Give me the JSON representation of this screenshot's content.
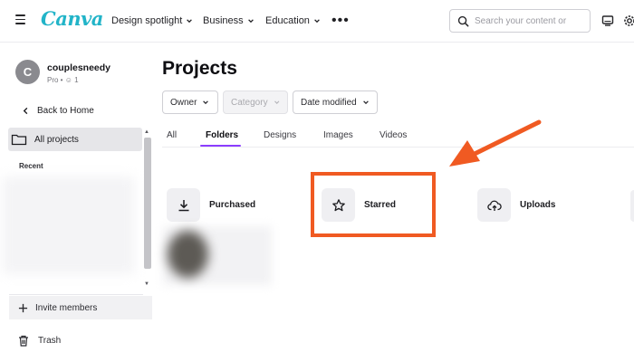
{
  "header": {
    "logo": "Canva",
    "nav": [
      "Design spotlight",
      "Business",
      "Education"
    ],
    "more": "•••",
    "search_placeholder": "Search your content or",
    "icons": [
      "menu-icon",
      "chevron-down-icon",
      "more-icon",
      "search-icon",
      "desktop-icon",
      "settings-icon"
    ]
  },
  "sidebar": {
    "avatar_initial": "C",
    "user_name": "couplesneedy",
    "user_plan": "Pro • ☺ 1",
    "back_home": "Back to Home",
    "all_projects": "All projects",
    "recent_heading": "Recent",
    "invite_members": "Invite members",
    "trash": "Trash"
  },
  "main": {
    "title": "Projects",
    "filters": [
      {
        "label": "Owner",
        "enabled": true
      },
      {
        "label": "Category",
        "enabled": false
      },
      {
        "label": "Date modified",
        "enabled": true
      }
    ],
    "tabs": [
      {
        "label": "All",
        "active": false
      },
      {
        "label": "Folders",
        "active": true
      },
      {
        "label": "Designs",
        "active": false
      },
      {
        "label": "Images",
        "active": false
      },
      {
        "label": "Videos",
        "active": false
      }
    ],
    "folders": [
      {
        "label": "Purchased",
        "icon": "download-icon"
      },
      {
        "label": "Starred",
        "icon": "star-icon"
      },
      {
        "label": "Uploads",
        "icon": "cloud-upload-icon"
      }
    ]
  },
  "annotation": {
    "color": "#f05a22",
    "highlighted": "Starred"
  },
  "colors": {
    "brand": "#22b4c8",
    "accent": "#8b3dff",
    "sidebar_active": "#e6e6e9"
  }
}
